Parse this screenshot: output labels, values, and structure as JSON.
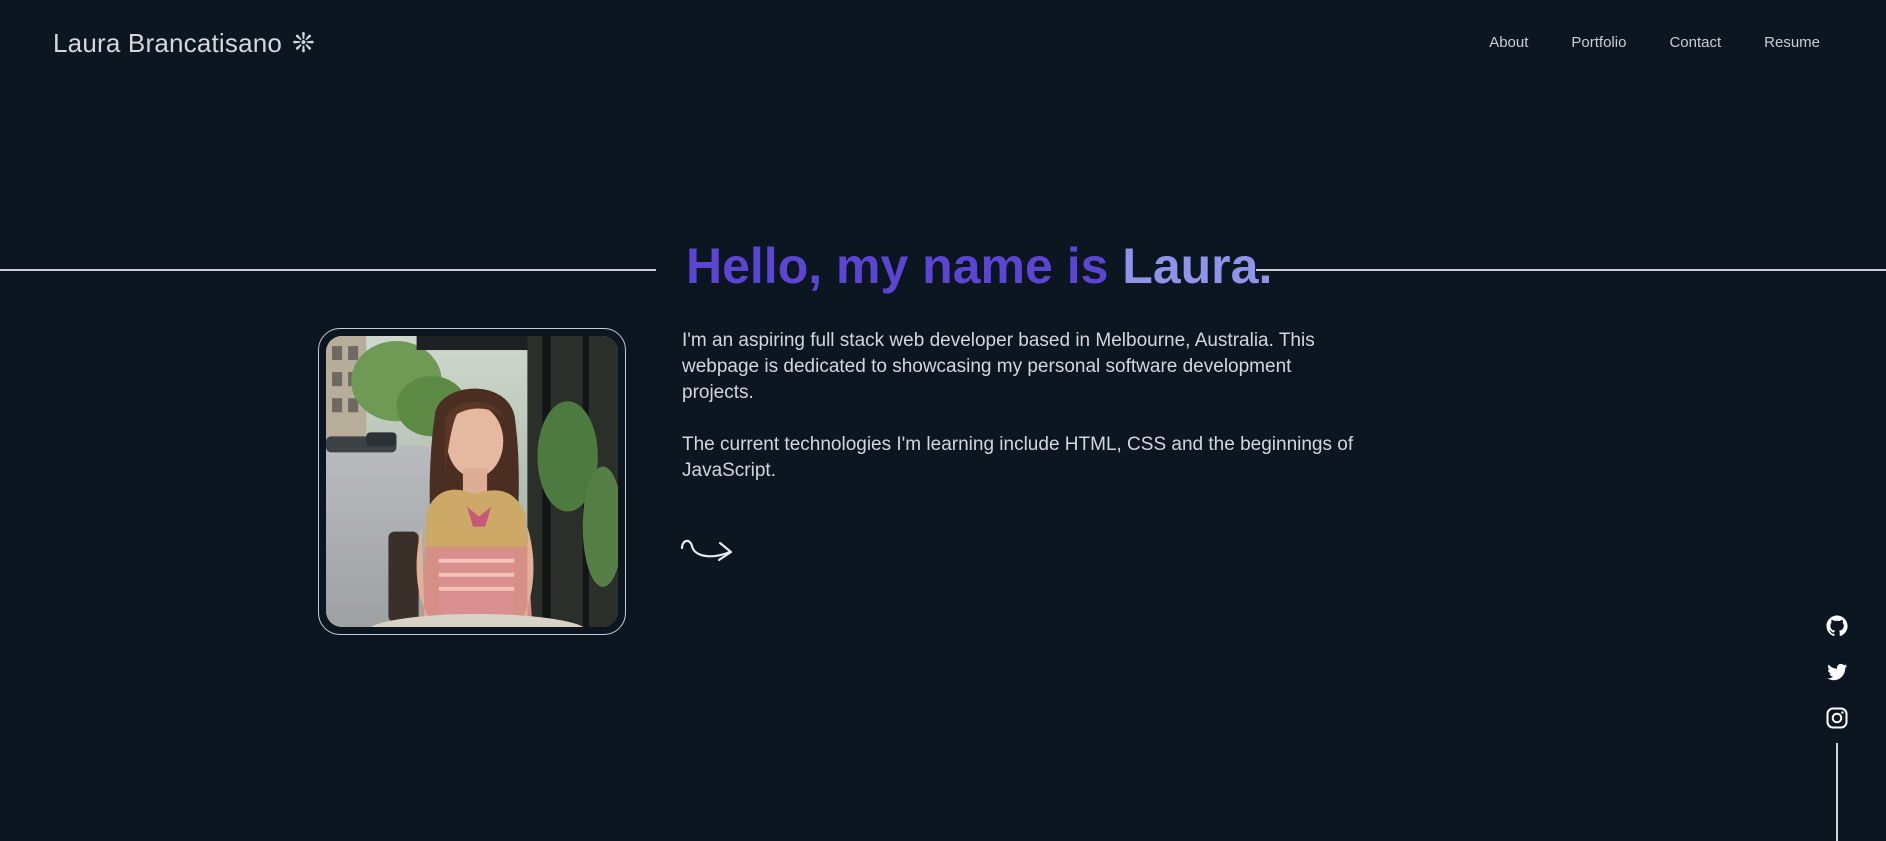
{
  "header": {
    "logo_text": "Laura Brancatisano",
    "logo_glyph": "❊",
    "nav": [
      {
        "label": "About"
      },
      {
        "label": "Portfolio"
      },
      {
        "label": "Contact"
      },
      {
        "label": "Resume"
      }
    ]
  },
  "hero": {
    "title_prefix": "Hello, my name is ",
    "title_name": "Laura."
  },
  "bio": {
    "paragraph_1": "I'm an aspiring full stack web developer based in Melbourne, Australia. This webpage is dedicated to showcasing my personal software development projects.",
    "paragraph_2": "The current technologies I'm learning include HTML, CSS and the beginnings of JavaScript."
  },
  "icons": {
    "arrow": "arrow-right-icon",
    "social": [
      "github-icon",
      "twitter-icon",
      "instagram-icon"
    ]
  },
  "colors": {
    "background": "#0b1621",
    "title_primary": "#5b45d2",
    "title_accent": "#8f93ea",
    "text": "#d3d7dd"
  }
}
